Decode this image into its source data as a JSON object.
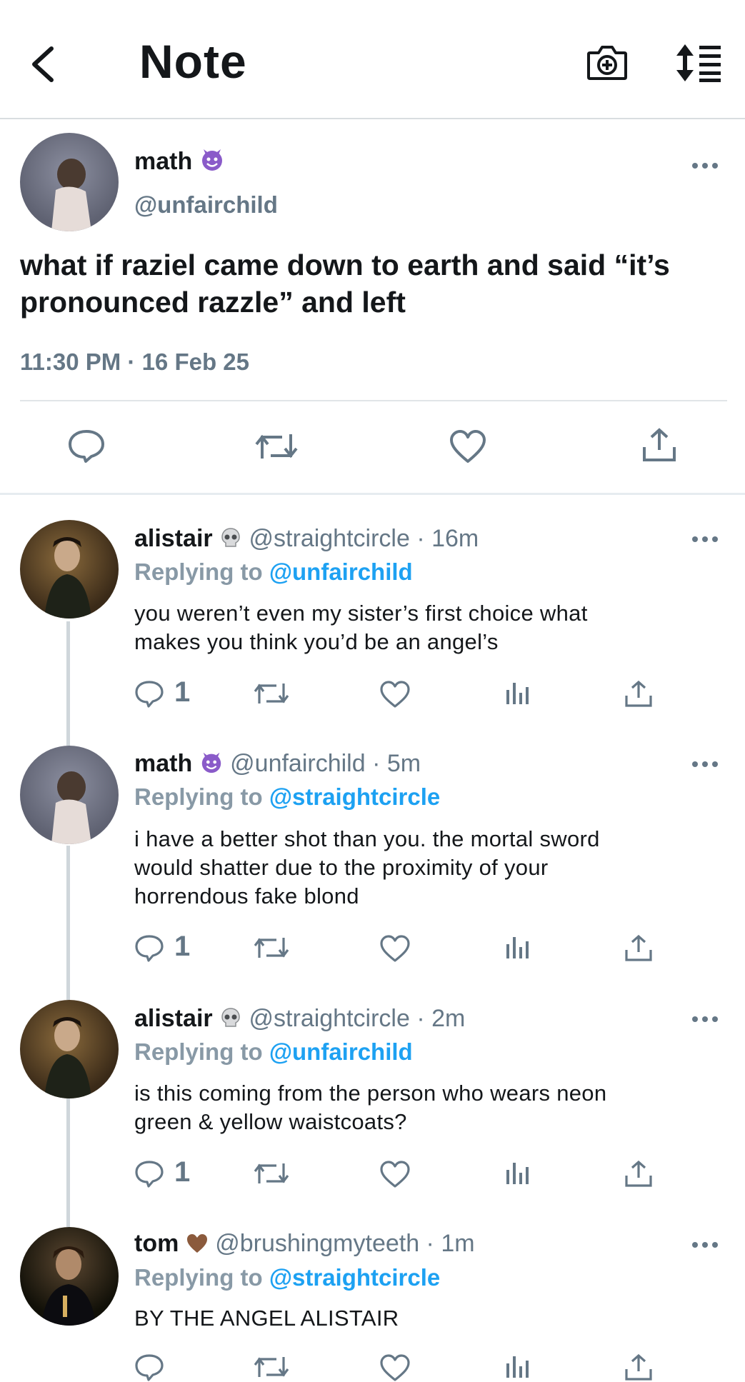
{
  "header": {
    "title": "Note",
    "back_icon": "chevron-left-icon",
    "camera_icon": "camera-plus-icon",
    "sort_icon": "sort-list-icon"
  },
  "main_tweet": {
    "name": "math",
    "name_emoji": "smiling-devil",
    "handle": "@unfairchild",
    "text": "what if raziel came down to earth and said “it’s pronounced razzle” and left",
    "timestamp": "11:30 PM · 16 Feb 25"
  },
  "replies": [
    {
      "name": "alistair",
      "emoji": "skull",
      "handle": "@straightcircle · 16m",
      "replying_prefix": "Replying to ",
      "replying_to": "@unfairchild",
      "line1": "you weren’t even my sister’s first choice what",
      "line2": "makes you think you’d be an angel’s",
      "line3": "",
      "reply_count": "1"
    },
    {
      "name": "math",
      "emoji": "smiling-devil",
      "handle": "@unfairchild · 5m",
      "replying_prefix": "Replying to ",
      "replying_to": "@straightcircle",
      "line1": "i have a better shot than you. the mortal sword",
      "line2": "would shatter due to the proximity of your",
      "line3": "horrendous fake blond",
      "reply_count": "1"
    },
    {
      "name": "alistair",
      "emoji": "skull",
      "handle": "@straightcircle · 2m",
      "replying_prefix": "Replying to ",
      "replying_to": "@unfairchild",
      "line1": "is this coming from the person who wears neon",
      "line2": "green & yellow waistcoats?",
      "line3": "",
      "reply_count": "1"
    },
    {
      "name": "tom",
      "emoji": "brown-heart",
      "handle": "@brushingmyteeth · 1m",
      "replying_prefix": "Replying to ",
      "replying_to": "@straightcircle",
      "line1": "BY THE ANGEL ALISTAIR",
      "line2": "",
      "line3": "",
      "reply_count": ""
    }
  ],
  "colors": {
    "link": "#1da1f2",
    "muted": "#657786",
    "text": "#14171a",
    "divider": "#e1e5e8"
  }
}
